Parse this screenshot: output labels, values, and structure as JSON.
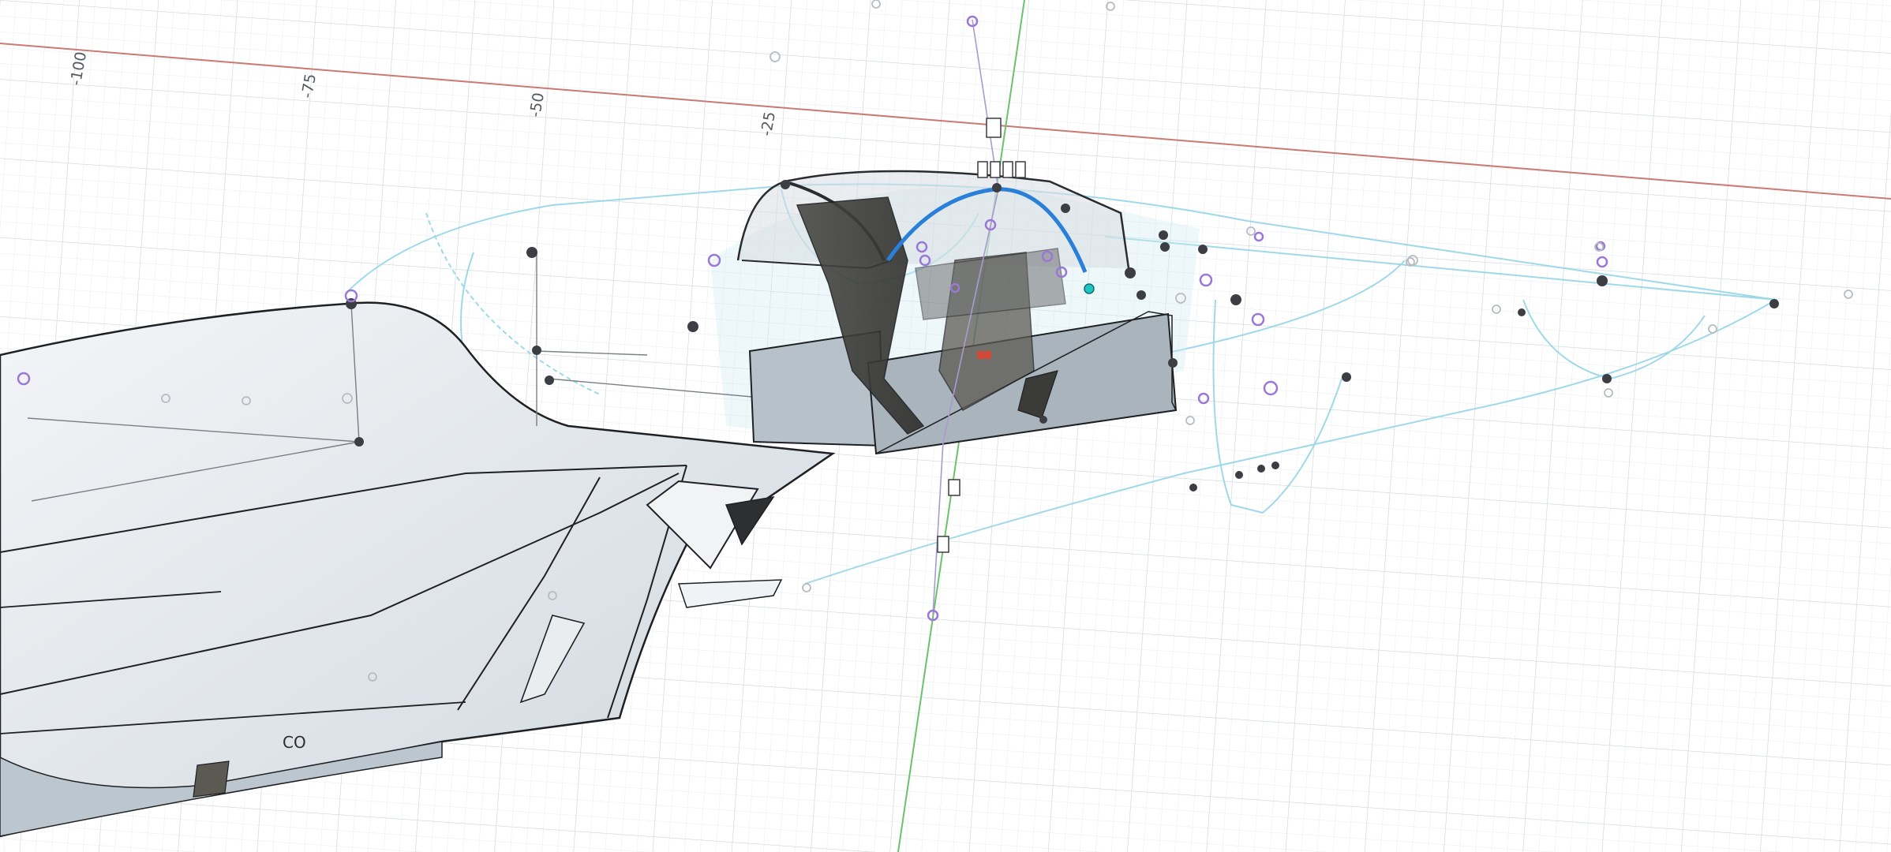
{
  "viewport": {
    "name": "3D modeling canvas",
    "background": "#ffffff",
    "grid_color": "#dde2e7",
    "x_axis_color": "#c97a72",
    "y_axis_color": "#6cc26c",
    "body_color": "#e4e9ee",
    "edge_color": "#1e2023",
    "sketch_color": "#8fd3e6",
    "selection_color": "#2a7fd9",
    "control_point_color": "#9b78d6"
  },
  "ruler": {
    "labels": [
      "-100",
      "-75",
      "-50",
      "-25"
    ]
  },
  "model": {
    "body": "fuselage",
    "components": [
      "canopy",
      "cockpit-seat",
      "instrument-panel",
      "fuselage-sketch-profile"
    ]
  }
}
